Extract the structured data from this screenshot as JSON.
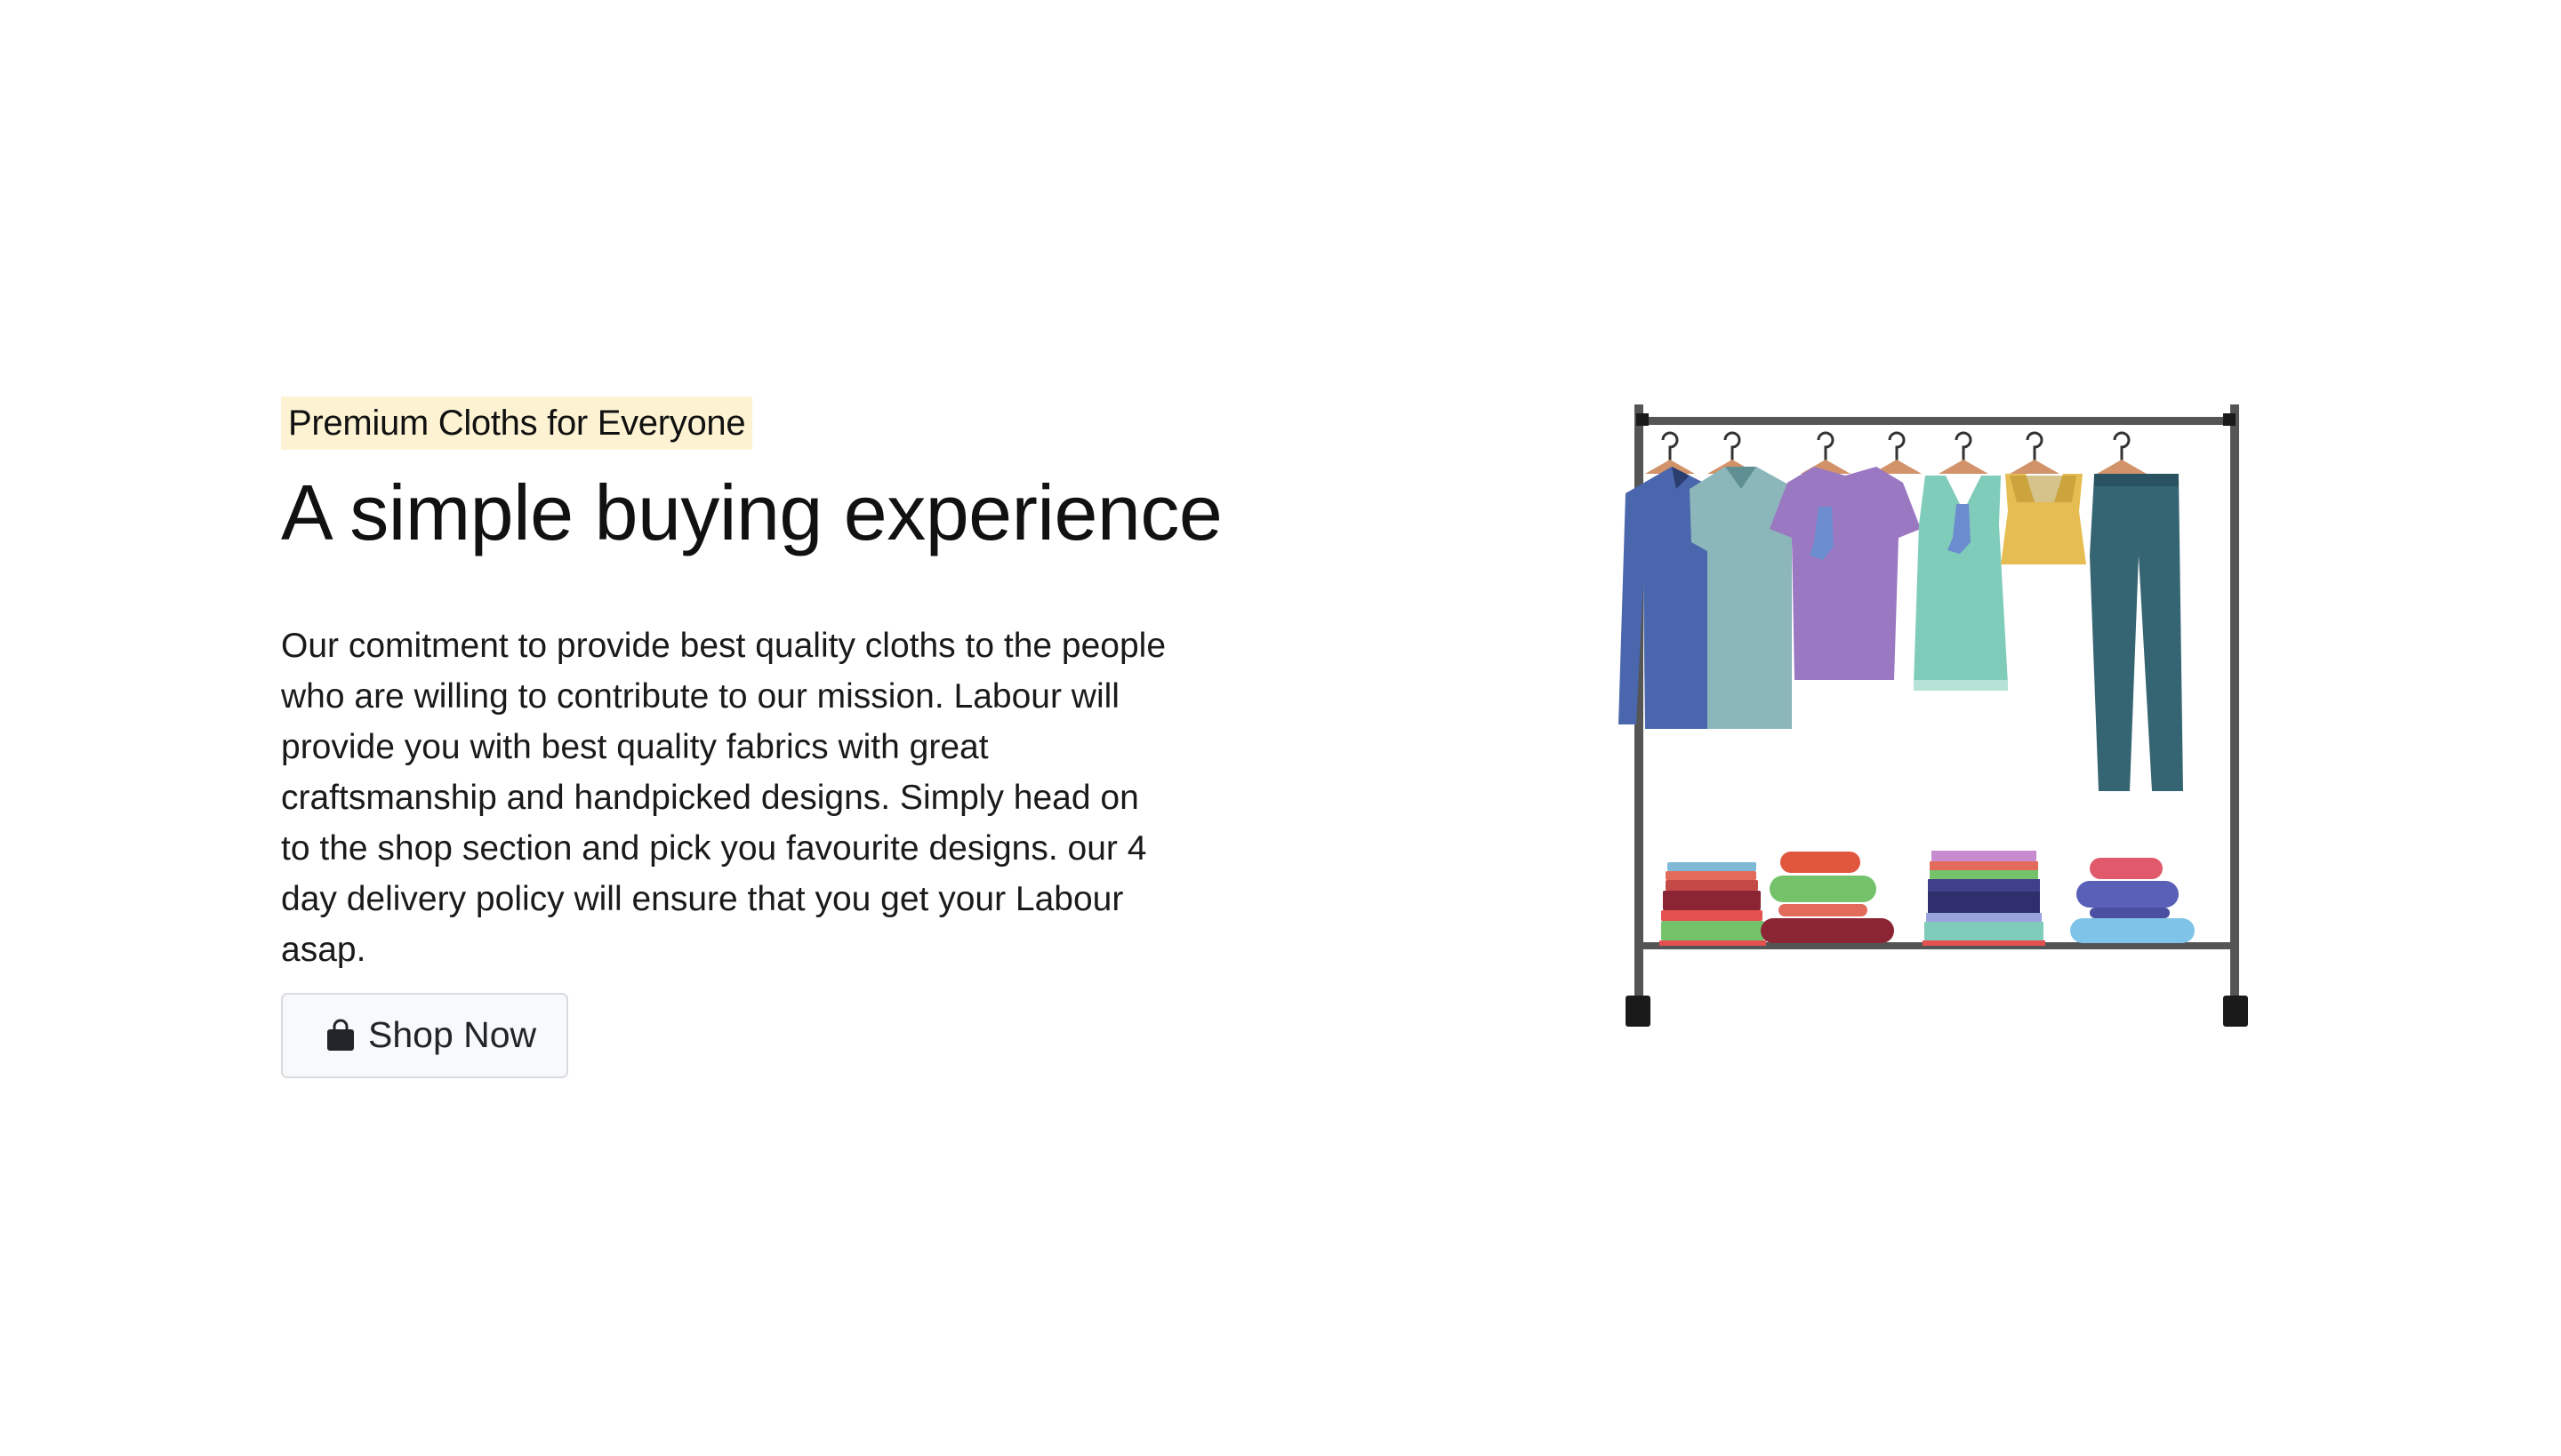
{
  "hero": {
    "tagline": "Premium Cloths for Everyone",
    "headline": "A simple buying experience",
    "description": "Our comitment to provide best quality cloths to the people who are willing to contribute to our mission. Labour will provide you with best quality fabrics with great craftsmanship and handpicked designs. Simply head on to the shop section and pick you favourite designs. our 4 day delivery policy will ensure that you get your Labour asap.",
    "cta_label": "Shop Now",
    "cta_icon": "shopping-bag-icon"
  },
  "colors": {
    "tagline_bg": "#fdf3d3",
    "button_bg": "#f8f9fa",
    "rack": "#555555"
  }
}
